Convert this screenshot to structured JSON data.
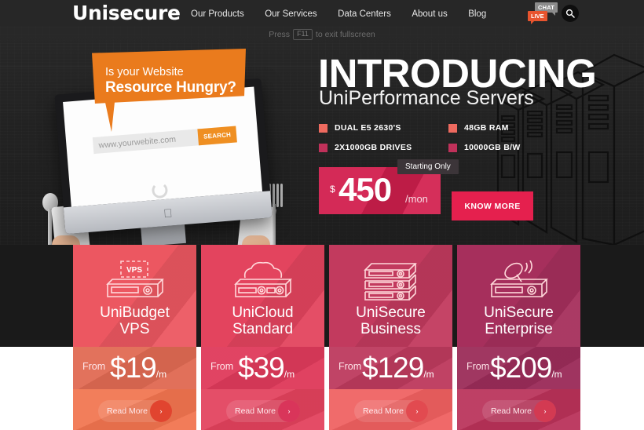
{
  "header": {
    "logo": "Unisecure",
    "nav": [
      {
        "label": "Our Products"
      },
      {
        "label": "Our Services"
      },
      {
        "label": "Data Centers"
      },
      {
        "label": "About us"
      },
      {
        "label": "Blog"
      }
    ],
    "chat_badge": {
      "top": "CHAT",
      "bottom": "LIVE"
    },
    "search_icon": "search-icon"
  },
  "fullscreen_hint": {
    "prefix": "Press",
    "key": "F11",
    "suffix": "to exit fullscreen"
  },
  "hero": {
    "callout": {
      "line1": "Is your Website",
      "line2": "Resource Hungry?",
      "color": "#ea7b1d"
    },
    "browser": {
      "url": "www.yourwebite.com",
      "search_button": "SEARCH"
    },
    "title": "INTRODUCING",
    "subtitle": "UniPerformance Servers",
    "specs": [
      {
        "label": "DUAL E5 2630'S",
        "color": "#ee6a5f"
      },
      {
        "label": "48GB RAM",
        "color": "#ee6a5f"
      },
      {
        "label": "2X1000GB DRIVES",
        "color": "#c0315a"
      },
      {
        "label": "10000GB B/W",
        "color": "#c0315a"
      }
    ],
    "price": {
      "currency": "$",
      "amount": "450",
      "period": "/mon",
      "badge": "Starting Only",
      "box_color": "#d21f4e"
    },
    "cta": {
      "label": "KNOW MORE",
      "color": "#e5204e"
    }
  },
  "plans": [
    {
      "icon": "vps-server-icon",
      "icon_label": "VPS",
      "title_line1": "UniBudget",
      "title_line2": "VPS",
      "from_label": "From",
      "currency": "$",
      "price": "19",
      "period": "/m",
      "read_more": "Read More",
      "arrow": "›",
      "top_color": "#ec5761",
      "price_color": "#e06a53",
      "foot_color": "#f1744f",
      "circle_color": "#e1442f"
    },
    {
      "icon": "cloud-server-icon",
      "icon_label": "",
      "title_line1": "UniCloud",
      "title_line2": "Standard",
      "from_label": "From",
      "currency": "$",
      "price": "39",
      "period": "/m",
      "read_more": "Read More",
      "arrow": "›",
      "top_color": "#e3445e",
      "price_color": "#df3a5b",
      "foot_color": "#e2415c",
      "circle_color": "#d9355a"
    },
    {
      "icon": "stacked-servers-icon",
      "icon_label": "",
      "title_line1": "UniSecure",
      "title_line2": "Business",
      "from_label": "From",
      "currency": "$",
      "price": "129",
      "period": "/m",
      "read_more": "Read More",
      "arrow": "›",
      "top_color": "#c23a5e",
      "price_color": "#bd3a5e",
      "foot_color": "#ef6060",
      "circle_color": "#e24a50"
    },
    {
      "icon": "satellite-server-icon",
      "icon_label": "",
      "title_line1": "UniSecure",
      "title_line2": "Enterprise",
      "from_label": "From",
      "currency": "$",
      "price": "209",
      "period": "/m",
      "read_more": "Read More",
      "arrow": "›",
      "top_color": "#a62f5c",
      "price_color": "#9b2c59",
      "foot_color": "#b93159",
      "circle_color": "#d33a52"
    }
  ]
}
